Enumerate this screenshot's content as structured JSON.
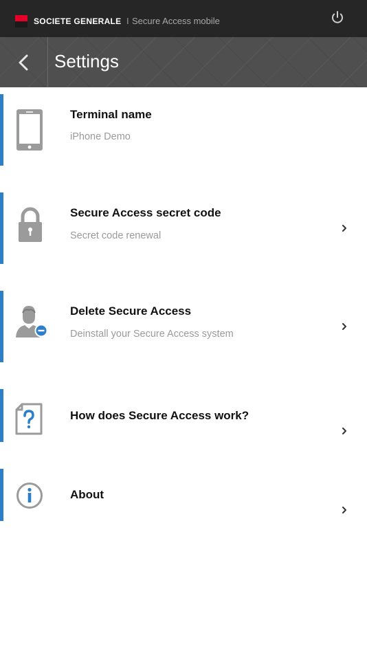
{
  "topbar": {
    "brand_name": "SOCIETE GENERALE",
    "separator": "I",
    "app_name": "Secure Access mobile"
  },
  "header": {
    "title": "Settings"
  },
  "settings": {
    "items": [
      {
        "title": "Terminal name",
        "subtitle": "iPhone Demo",
        "icon": "smartphone-icon",
        "has_chevron": false
      },
      {
        "title": "Secure Access secret code",
        "subtitle": "Secret code renewal",
        "icon": "padlock-icon",
        "has_chevron": true
      },
      {
        "title": "Delete Secure Access",
        "subtitle": "Deinstall your Secure Access system",
        "icon": "user-remove-icon",
        "has_chevron": true
      },
      {
        "title": "How does Secure Access work?",
        "icon": "help-document-icon",
        "has_chevron": true
      },
      {
        "title": "About",
        "icon": "info-icon",
        "has_chevron": true
      }
    ]
  },
  "colors": {
    "accent": "#2d7fc7",
    "topbar": "#262626",
    "header": "#4f4f4f",
    "brand_red": "#e60028"
  }
}
